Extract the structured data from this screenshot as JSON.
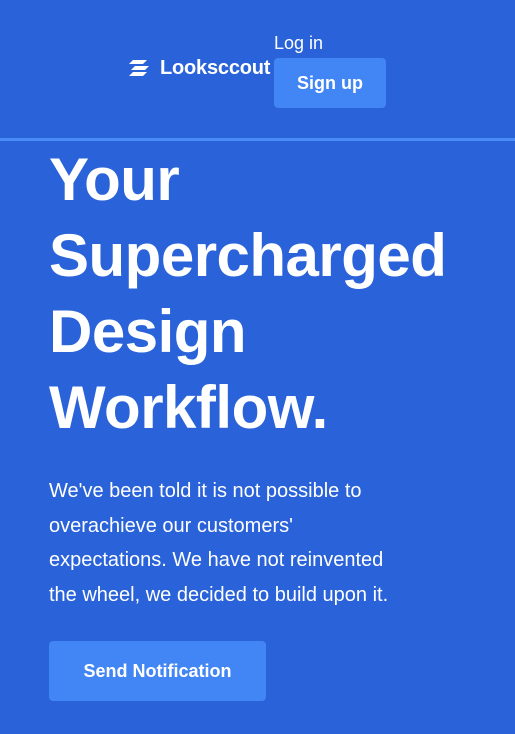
{
  "header": {
    "brand_name": "Looksccout",
    "login_label": "Log in",
    "signup_label": "Sign up"
  },
  "hero": {
    "title_lines": [
      "Your",
      "Supercharged",
      "Design",
      "Workflow."
    ],
    "description_lines": [
      "We've been told it is not possible to",
      "overachieve our customers'",
      "expectations. We have not reinvented",
      "the wheel, we decided to build upon it."
    ],
    "cta_label": "Send Notification"
  },
  "icons": {
    "brand": "stacked-stripes-logo-icon"
  },
  "colors": {
    "background": "#2962d9",
    "button": "#4285f4",
    "divider": "#4a8cf7",
    "text": "#ffffff"
  }
}
